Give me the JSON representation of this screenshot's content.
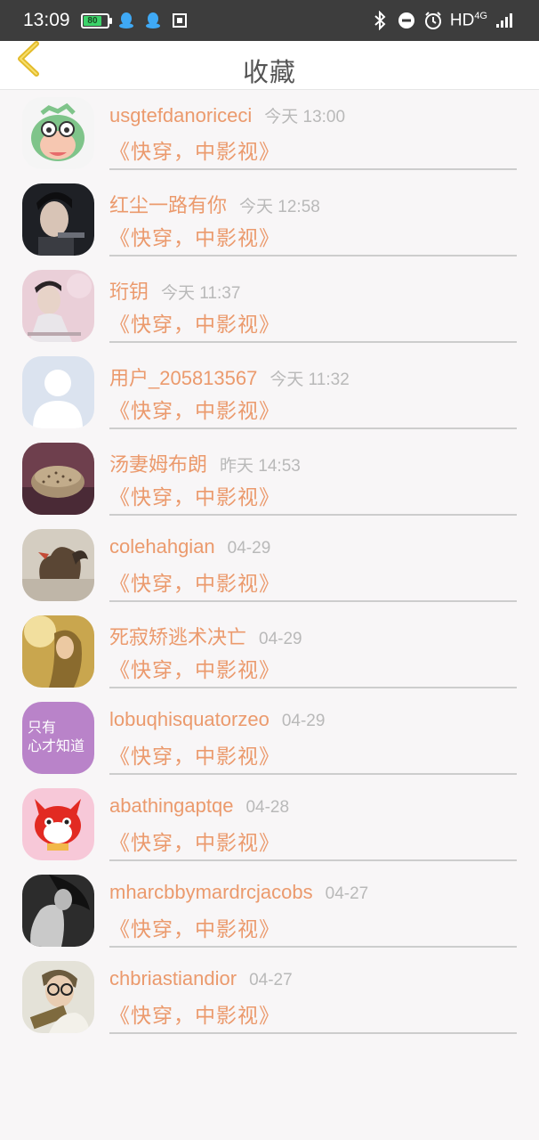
{
  "status_bar": {
    "time": "13:09",
    "battery": "80",
    "network": "HD",
    "network_gen": "4G",
    "icons": [
      "qq-icon",
      "qq-icon",
      "screenshot-icon",
      "bluetooth-icon",
      "do-not-disturb-icon",
      "alarm-icon",
      "signal-icon"
    ]
  },
  "header": {
    "title": "收藏",
    "back_icon": "chevron-left-icon"
  },
  "colors": {
    "accent": "#eb9a6d",
    "back_arrow": "#e3bb2a",
    "status_bar_bg": "#3d3d3d"
  },
  "items": [
    {
      "name": "usgtefdanoriceci",
      "time": "今天 13:00",
      "content": "《快穿，中影视》"
    },
    {
      "name": "红尘一路有你",
      "time": "今天 12:58",
      "content": "《快穿，中影视》"
    },
    {
      "name": "珩钥",
      "time": "今天 11:37",
      "content": "《快穿，中影视》"
    },
    {
      "name": "用户_205813567",
      "time": "今天 11:32",
      "content": "《快穿，中影视》"
    },
    {
      "name": "汤妻姆布朗",
      "time": "昨天 14:53",
      "content": "《快穿，中影视》"
    },
    {
      "name": "colehahgian",
      "time": "04-29",
      "content": "《快穿，中影视》"
    },
    {
      "name": "死寂矫逃术决亡",
      "time": "04-29",
      "content": "《快穿，中影视》"
    },
    {
      "name": "lobuqhisquatorzeo",
      "time": "04-29",
      "content": "《快穿，中影视》",
      "avatar_text_1": "只有",
      "avatar_text_2": "心才知道"
    },
    {
      "name": "abathingaptqe",
      "time": "04-28",
      "content": "《快穿，中影视》"
    },
    {
      "name": "mharcbbymardrcjacobs",
      "time": "04-27",
      "content": "《快穿，中影视》"
    },
    {
      "name": "chbriastiandior",
      "time": "04-27",
      "content": "《快穿，中影视》"
    }
  ]
}
